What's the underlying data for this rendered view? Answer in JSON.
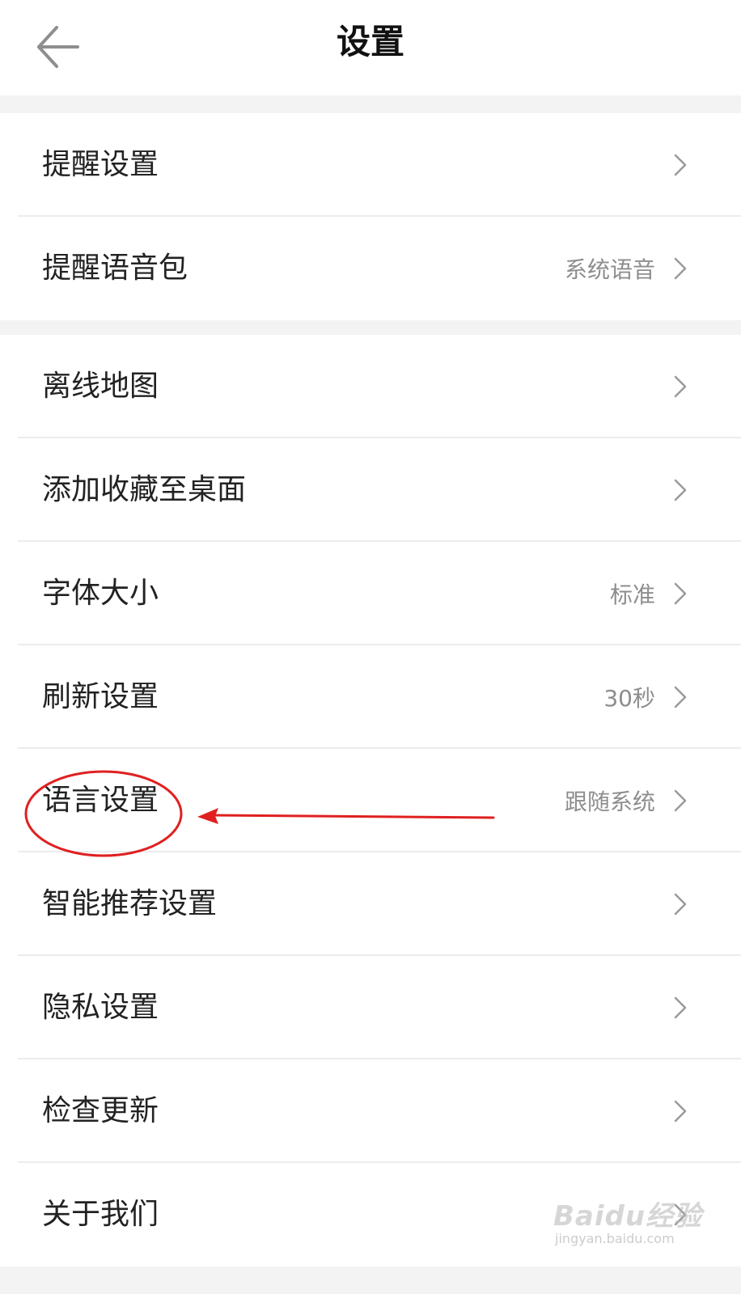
{
  "header": {
    "title": "设置",
    "back_icon": "arrow-left-icon"
  },
  "groups": [
    {
      "items": [
        {
          "label": "提醒设置",
          "value": ""
        },
        {
          "label": "提醒语音包",
          "value": "系统语音"
        }
      ]
    },
    {
      "items": [
        {
          "label": "离线地图",
          "value": ""
        },
        {
          "label": "添加收藏至桌面",
          "value": ""
        },
        {
          "label": "字体大小",
          "value": "标准"
        },
        {
          "label": "刷新设置",
          "value": "30秒"
        },
        {
          "label": "语言设置",
          "value": "跟随系统"
        },
        {
          "label": "智能推荐设置",
          "value": ""
        },
        {
          "label": "隐私设置",
          "value": ""
        },
        {
          "label": "检查更新",
          "value": ""
        },
        {
          "label": "关于我们",
          "value": ""
        }
      ]
    }
  ],
  "annotation": {
    "highlighted_item": "语言设置",
    "color": "#e02020"
  },
  "watermark": {
    "brand": "Baidu经验",
    "url": "jingyan.baidu.com"
  },
  "colors": {
    "background": "#f3f3f3",
    "card": "#ffffff",
    "secondary_text": "#8d8d8d",
    "chevron": "#9a9a9a"
  }
}
